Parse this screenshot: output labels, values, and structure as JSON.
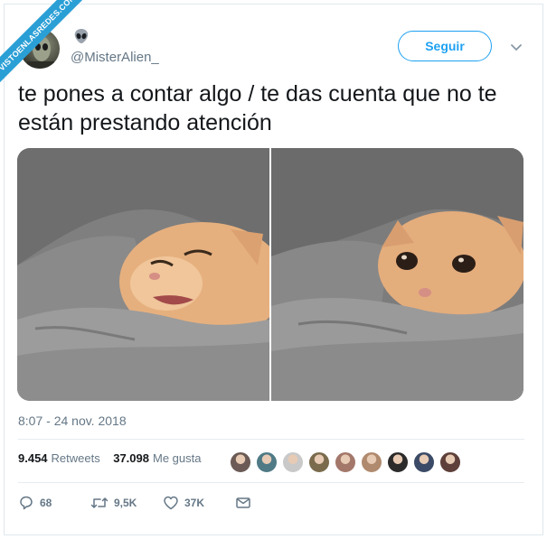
{
  "watermark": {
    "text": "VISTOENLASREDES.COM"
  },
  "header": {
    "handle": "@MisterAlien_",
    "follow_label": "Seguir",
    "name_icon": "alien-icon",
    "menu_icon": "chevron-down-icon"
  },
  "tweet": {
    "text": "te pones a contar algo / te das cuenta que no te están prestando atención",
    "media": [
      {
        "name": "photo-cat-talking",
        "description_icon": "cat-photo"
      },
      {
        "name": "photo-cat-sad",
        "description_icon": "cat-photo"
      }
    ],
    "timestamp": "8:07 - 24 nov. 2018"
  },
  "stats": {
    "retweets_count": "9.454",
    "retweets_label": "Retweets",
    "likes_count": "37.098",
    "likes_label": "Me gusta"
  },
  "liker_avatars": [
    "#6b5a55",
    "#4f7a86",
    "#c9c9c9",
    "#7a6b4c",
    "#a3786a",
    "#b08a6e",
    "#2b2b2b",
    "#3b4a66",
    "#5e3f3a"
  ],
  "actions": {
    "reply_count": "68",
    "retweet_count": "9,5K",
    "like_count": "37K"
  },
  "colors": {
    "accent": "#1da1f2",
    "muted": "#657786",
    "text": "#14171a",
    "border": "#e6ecf0",
    "ribbon": "#2a9fd6"
  }
}
